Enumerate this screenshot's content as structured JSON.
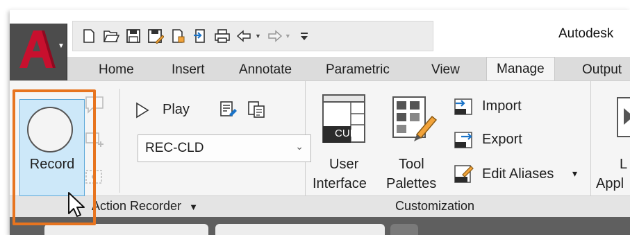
{
  "window": {
    "title": "Autodesk"
  },
  "quick_access": {
    "icons": [
      "new-icon",
      "open-icon",
      "save-icon",
      "save-as-icon",
      "open-from-mobile-icon",
      "upload-icon",
      "print-icon",
      "undo-icon",
      "redo-icon",
      "customize-qat-icon"
    ]
  },
  "tabs": [
    {
      "label": "Home"
    },
    {
      "label": "Insert"
    },
    {
      "label": "Annotate"
    },
    {
      "label": "Parametric"
    },
    {
      "label": "View"
    },
    {
      "label": "Manage",
      "active": true
    },
    {
      "label": "Output"
    }
  ],
  "action_recorder": {
    "record_label": "Record",
    "play_label": "Play",
    "macro_value": "REC-CLD",
    "panel_title": "Action Recorder",
    "panel_arrow": "▼"
  },
  "customization": {
    "cui_badge": "CUI",
    "user_interface_line1": "User",
    "user_interface_line2": "Interface",
    "tool_palettes_line1": "Tool",
    "tool_palettes_line2": "Palettes",
    "import_label": "Import",
    "export_label": "Export",
    "edit_aliases_label": "Edit Aliases",
    "edit_aliases_arrow": "▾",
    "panel_title": "Customization"
  },
  "applications": {
    "load_line1": "L",
    "load_line2": "Appl"
  },
  "colors": {
    "accent": "#e7741f",
    "selection": "#cde8f9",
    "brand_red": "#c8102e"
  }
}
